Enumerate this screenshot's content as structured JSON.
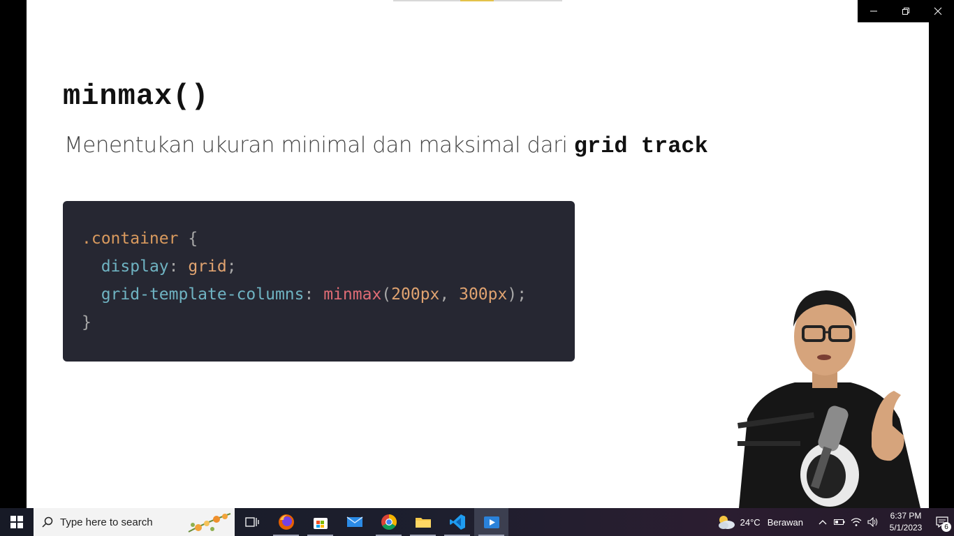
{
  "slide": {
    "title": "minmax()",
    "subtitle_text": "Menentukan ukuran minimal dan maksimal dari ",
    "subtitle_highlight": "grid track",
    "code": {
      "selector": ".container",
      "open_brace": " {",
      "prop1": "display",
      "val1": "grid",
      "prop2": "grid-template-columns",
      "fn": "minmax",
      "arg1": "200px",
      "arg2": "300px",
      "close_brace": "}"
    }
  },
  "taskbar": {
    "search_placeholder": "Type here to search",
    "apps": [
      "task-view",
      "firefox",
      "microsoft-store",
      "mail",
      "chrome",
      "file-explorer",
      "vscode",
      "media-player"
    ],
    "weather_temp": "24°C",
    "weather_desc": "Berawan",
    "time": "6:37 PM",
    "date": "5/1/2023",
    "notification_count": "6"
  }
}
